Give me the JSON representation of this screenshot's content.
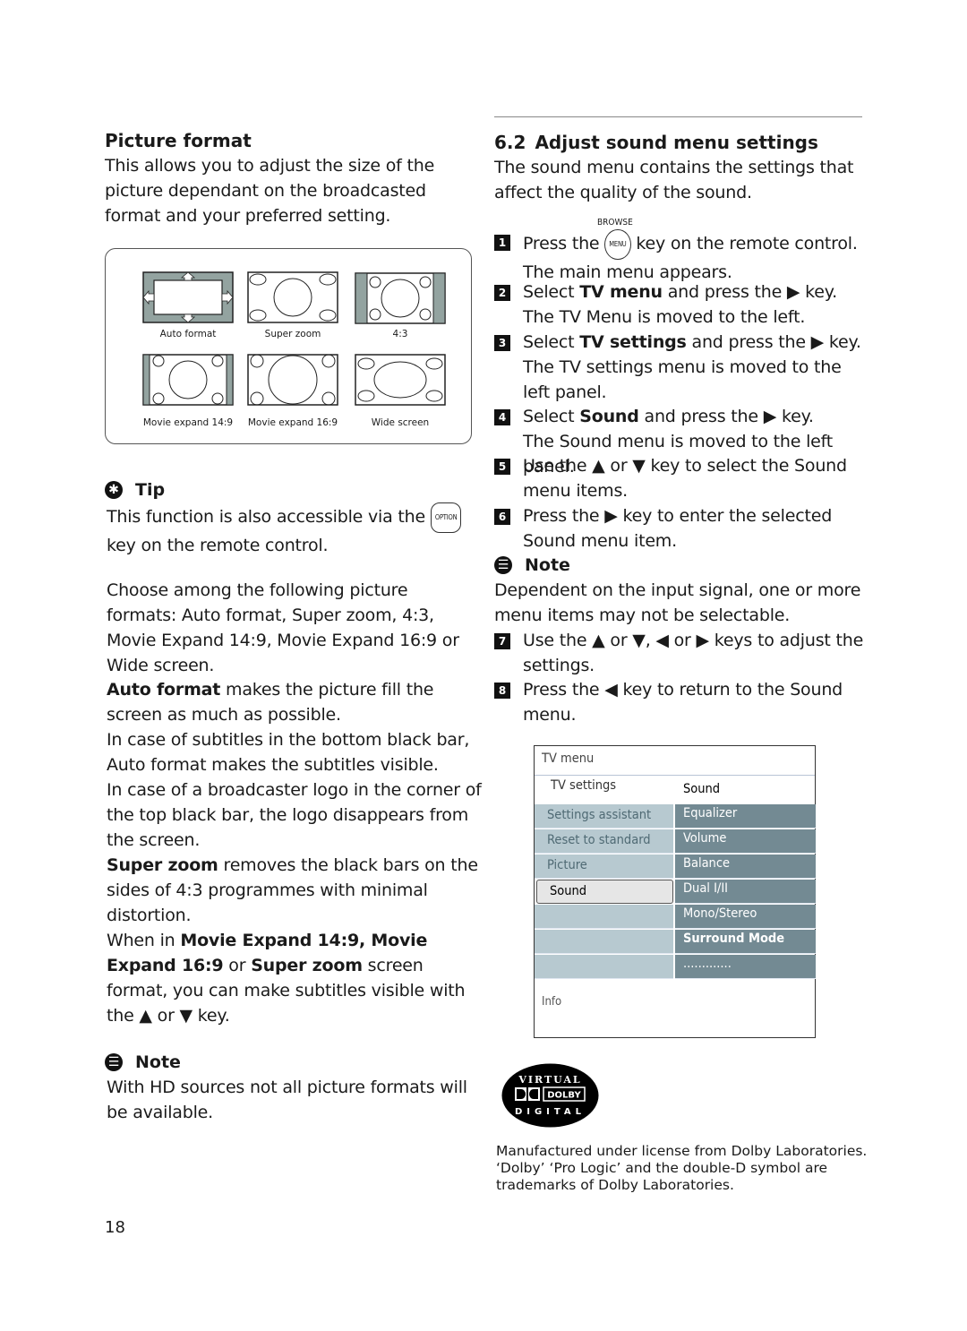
{
  "left": {
    "heading": "Picture format",
    "intro": "This allows you to adjust the size of the picture dependant on the broadcasted format and your preferred setting.",
    "figure": {
      "captions": [
        "Auto format",
        "Super zoom",
        "4:3",
        "Movie expand 14:9",
        "Movie expand 16:9",
        "Wide screen"
      ]
    },
    "tip": {
      "title": "Tip",
      "text_before": "This function is also accessible via the",
      "key_label": "OPTION",
      "text_after": "key on the remote control."
    },
    "choose": "Choose among the following picture formats: Auto format, Super zoom, 4:3, Movie Expand 14:9, Movie Expand 16:9 or Wide screen.",
    "auto_format": {
      "bold": "Auto format",
      "text": " makes the picture fill the screen as much as possible.",
      "p2": "In case of subtitles in the bottom black bar, Auto format makes the subtitles visible.",
      "p3": "In case of a broadcaster logo in the corner of the top black bar, the logo disappears from the screen."
    },
    "super_zoom": {
      "bold": "Super zoom",
      "text": " removes the black bars on the sides of 4:3 programmes with minimal distortion."
    },
    "movie_expand": {
      "t1": "When in ",
      "b1": "Movie Expand 14:9, Movie Expand 16:9",
      "t2": " or ",
      "b2": "Super zoom",
      "t3": " screen format, you can make subtitles visible with the ▲ or ▼ key."
    },
    "note": {
      "title": "Note",
      "text": "With HD sources not all picture formats will be available."
    },
    "page_number": "18"
  },
  "right": {
    "section_number": "6.2",
    "heading": "Adjust sound menu settings",
    "intro": "The sound menu contains the settings that affect the quality of the sound.",
    "browse_label": "BROWSE",
    "menu_key_label": "MENU",
    "steps": [
      {
        "n": "1",
        "pre": "Press the ",
        "post": " key on the remote control.",
        "sub": "The main menu appears."
      },
      {
        "n": "2",
        "pre": "Select ",
        "bold": "TV menu",
        "post": " and press the ▶ key.",
        "sub": "The TV Menu is moved to the left."
      },
      {
        "n": "3",
        "pre": "Select ",
        "bold": "TV settings",
        "post": " and press the ▶ key.",
        "sub": "The TV settings menu is moved to the left panel."
      },
      {
        "n": "4",
        "pre": "Select ",
        "bold": "Sound",
        "post": " and press the ▶ key.",
        "sub": "The Sound menu is moved to the left panel."
      },
      {
        "n": "5",
        "text": "Use the ▲ or ▼ key to select the Sound menu items."
      },
      {
        "n": "6",
        "text": "Press the ▶ key to enter the selected Sound menu item."
      },
      {
        "n": "7",
        "text": "Use the ▲ or ▼, ◀ or ▶ keys to adjust the settings."
      },
      {
        "n": "8",
        "text": "Press the ◀ key to return to the Sound menu."
      }
    ],
    "note": {
      "title": "Note",
      "text": "Dependent on the input signal, one or more menu items may not be selectable."
    },
    "tv_menu": {
      "title": "TV menu",
      "submenu": "TV settings",
      "submenu_selected": "Sound",
      "left_items": [
        "Settings assistant",
        "Reset to standard",
        "Picture",
        "Sound",
        "",
        "",
        ""
      ],
      "selected_left": "Sound",
      "right_items": [
        "Equalizer",
        "Volume",
        "Balance",
        "Dual I/II",
        "Mono/Stereo",
        "Surround Mode",
        "............."
      ],
      "info_label": "Info",
      "colors": {
        "left_bg": "#b7c9d0",
        "right_bg": "#738a93",
        "selected_bg": "#e6e6e6"
      }
    },
    "dolby_logo": {
      "top": "VIRTUAL",
      "mid": "DOLBY",
      "bottom": "DIGITAL"
    },
    "license_text": "Manufactured under license from Dolby Laboratories. ‘Dolby’ ‘Pro Logic’ and the double-D symbol are trademarks of Dolby Laboratories."
  }
}
